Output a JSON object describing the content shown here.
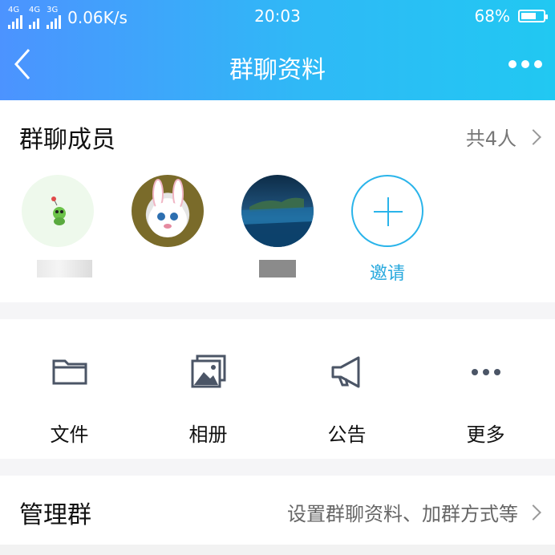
{
  "status_bar": {
    "network_left": "4G",
    "network_left2": "4G",
    "network_left3": "3G",
    "speed": "0.06K/s",
    "time": "20:03",
    "battery_percent": "68%",
    "battery_level": 0.68
  },
  "nav": {
    "title": "群聊资料"
  },
  "members": {
    "title": "群聊成员",
    "count_label": "共4人",
    "invite_label": "邀请"
  },
  "tools": [
    {
      "label": "文件",
      "icon": "folder-icon"
    },
    {
      "label": "相册",
      "icon": "album-icon"
    },
    {
      "label": "公告",
      "icon": "megaphone-icon"
    },
    {
      "label": "更多",
      "icon": "more-dots-icon"
    }
  ],
  "manage": {
    "title": "管理群",
    "subtitle": "设置群聊资料、加群方式等"
  },
  "colors": {
    "header_start": "#4c93ff",
    "header_end": "#21c8f2",
    "accent": "#2ab4ea"
  }
}
